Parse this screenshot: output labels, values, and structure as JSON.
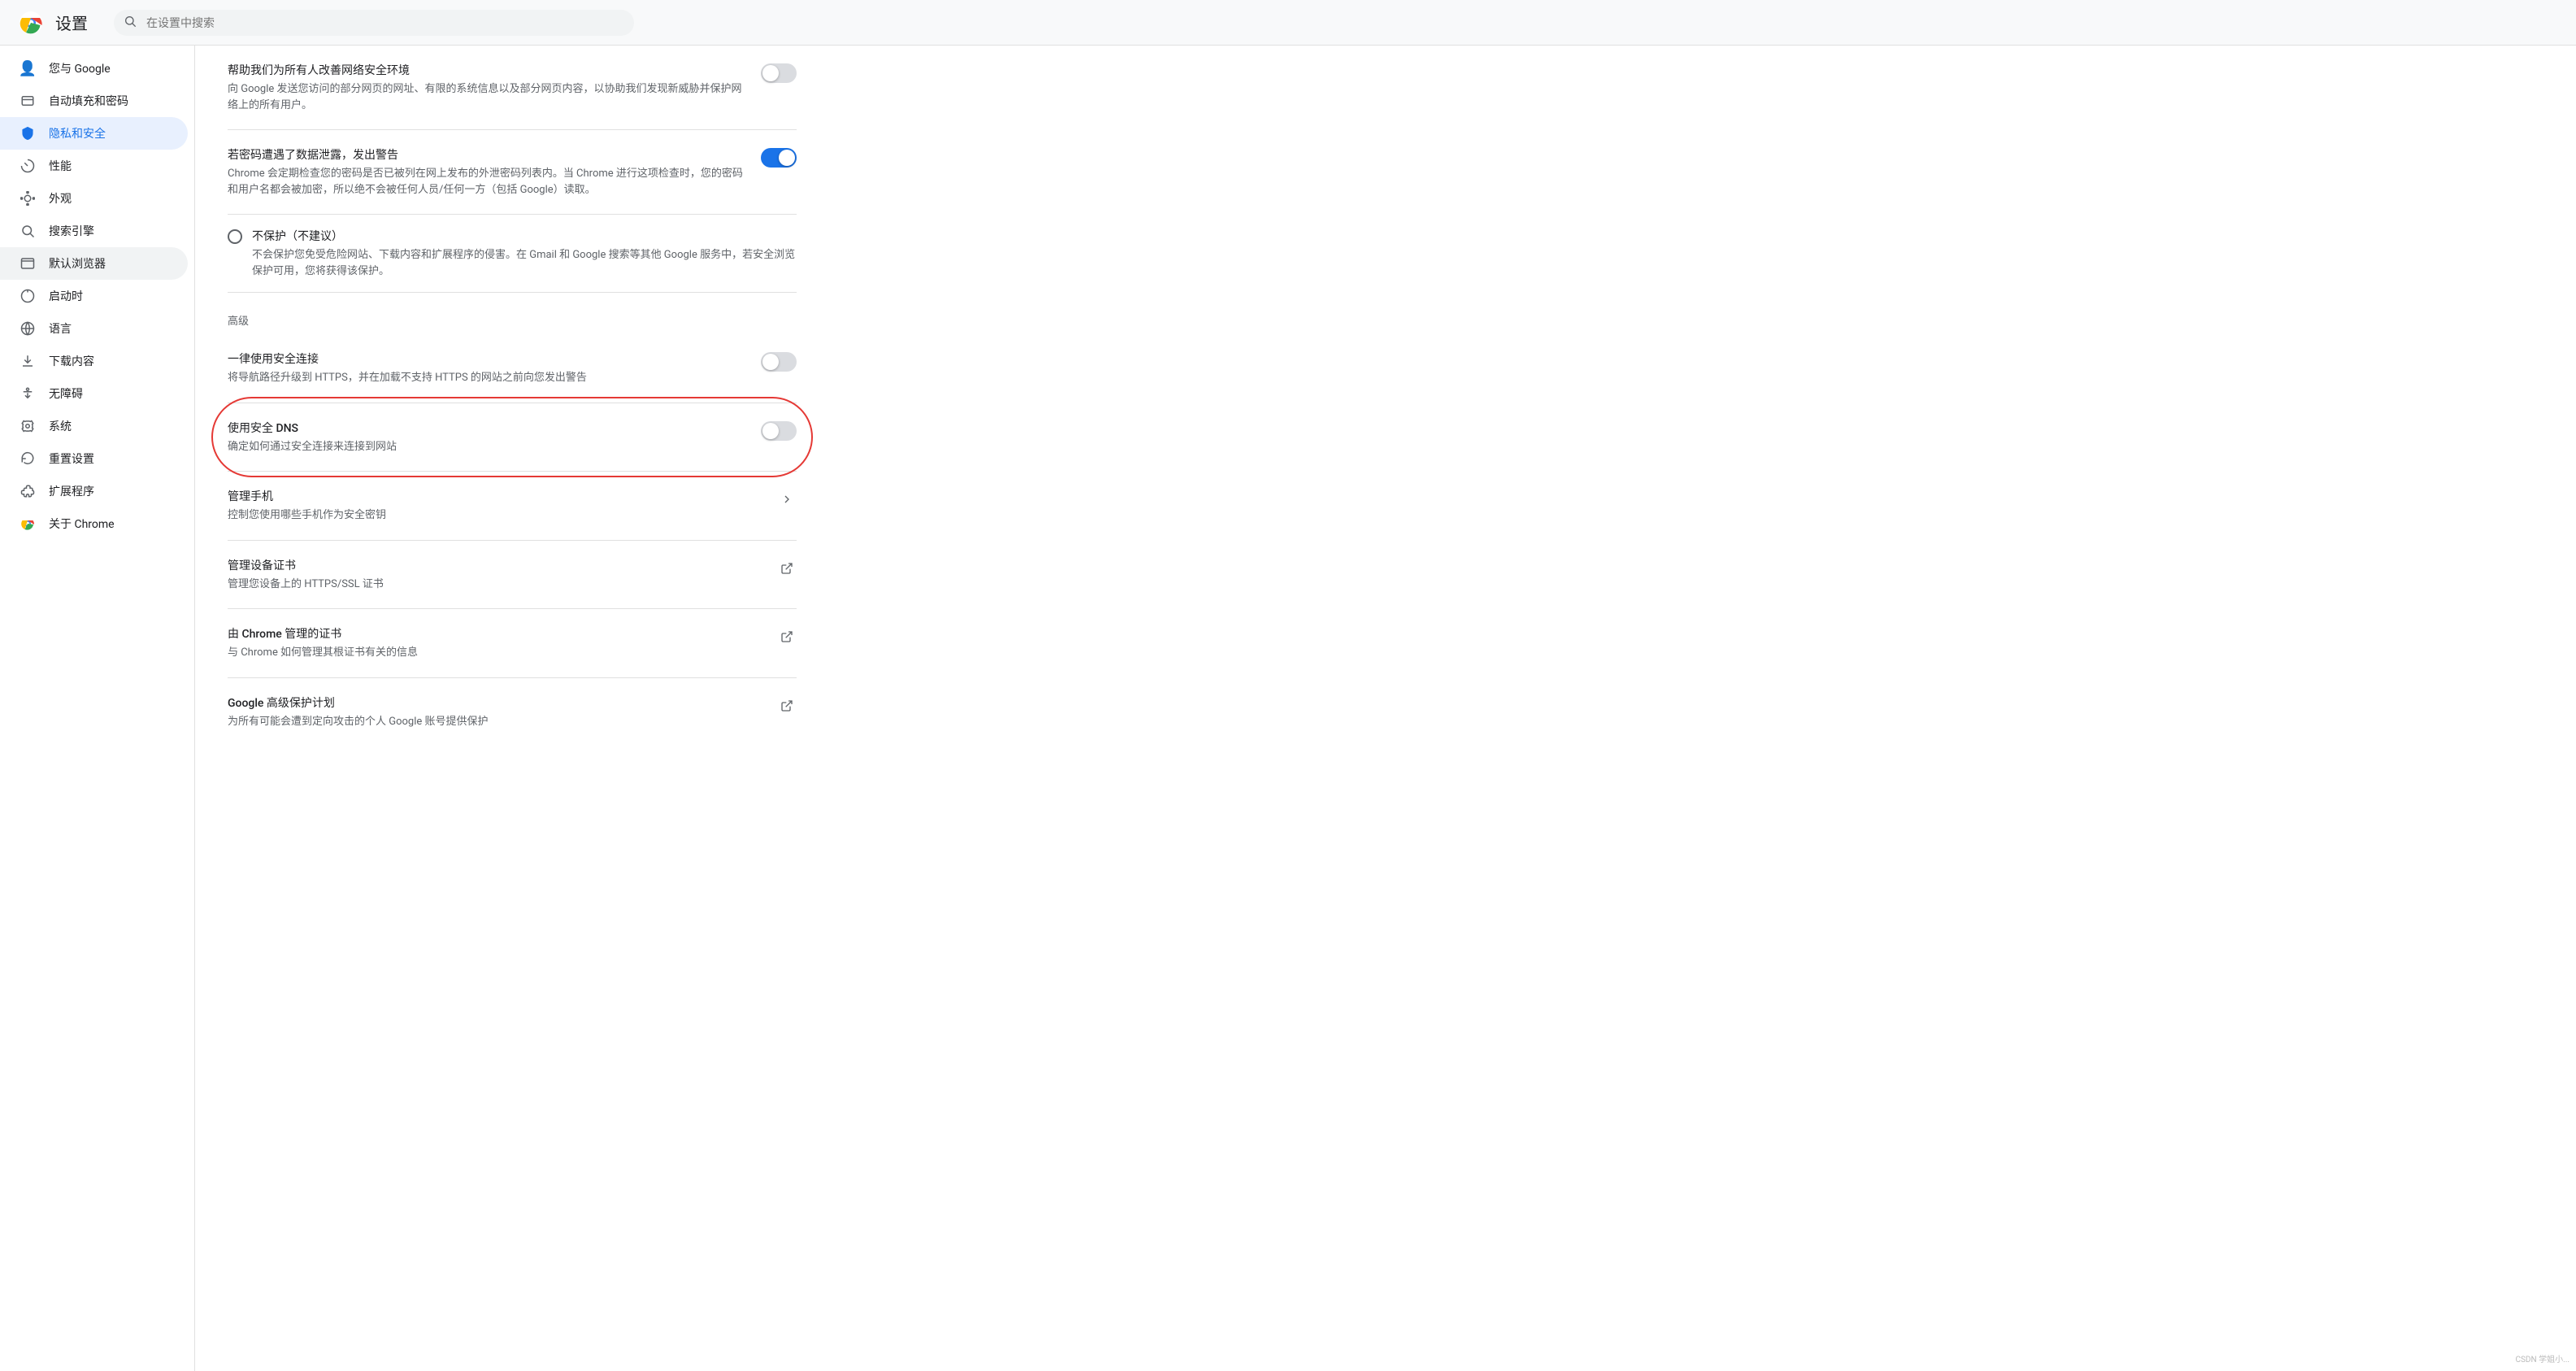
{
  "header": {
    "title": "设置",
    "search_placeholder": "在设置中搜索"
  },
  "sidebar": {
    "items": [
      {
        "id": "you-google",
        "label": "您与 Google",
        "icon": "👤"
      },
      {
        "id": "autofill",
        "label": "自动填充和密码",
        "icon": "🔄"
      },
      {
        "id": "privacy",
        "label": "隐私和安全",
        "icon": "🛡️",
        "active": true
      },
      {
        "id": "performance",
        "label": "性能",
        "icon": "⚡"
      },
      {
        "id": "appearance",
        "label": "外观",
        "icon": "🎨"
      },
      {
        "id": "search",
        "label": "搜索引擎",
        "icon": "🔍"
      },
      {
        "id": "default-browser",
        "label": "默认浏览器",
        "icon": "🖥️"
      },
      {
        "id": "startup",
        "label": "启动时",
        "icon": "🔌"
      },
      {
        "id": "languages",
        "label": "语言",
        "icon": "🌐"
      },
      {
        "id": "downloads",
        "label": "下载内容",
        "icon": "⬇️"
      },
      {
        "id": "accessibility",
        "label": "无障碍",
        "icon": "♿"
      },
      {
        "id": "system",
        "label": "系统",
        "icon": "🔧"
      },
      {
        "id": "reset",
        "label": "重置设置",
        "icon": "🔄"
      },
      {
        "id": "extensions",
        "label": "扩展程序",
        "icon": "🧩"
      },
      {
        "id": "about",
        "label": "关于 Chrome",
        "icon": "🌀"
      }
    ]
  },
  "content": {
    "help_network": {
      "title": "帮助我们为所有人改善网络安全环境",
      "desc": "向 Google 发送您访问的部分网页的网址、有限的系统信息以及部分网页内容，以协助我们发现新威胁并保护网络上的所有用户。",
      "toggle_state": "off"
    },
    "password_leak": {
      "title": "若密码遭遇了数据泄露，发出警告",
      "desc": "Chrome 会定期检查您的密码是否已被列在网上发布的外泄密码列表内。当 Chrome 进行这项检查时，您的密码和用户名都会被加密，所以绝不会被任何人员/任何一方（包括 Google）读取。",
      "toggle_state": "on"
    },
    "no_protection": {
      "title": "不保护（不建议）",
      "desc": "不会保护您免受危险网站、下载内容和扩展程序的侵害。在 Gmail 和 Google 搜索等其他 Google 服务中，若安全浏览保护可用，您将获得该保护。",
      "selected": false
    },
    "advanced_heading": "高级",
    "https_only": {
      "title": "一律使用安全连接",
      "desc": "将导航路径升级到 HTTPS，并在加载不支持 HTTPS 的网站之前向您发出警告",
      "toggle_state": "off"
    },
    "secure_dns": {
      "title": "使用安全 DNS",
      "desc": "确定如何通过安全连接来连接到网站",
      "toggle_state": "off",
      "highlighted": true
    },
    "manage_phone": {
      "title": "管理手机",
      "desc": "控制您使用哪些手机作为安全密钥",
      "has_arrow": true
    },
    "manage_device_certs": {
      "title": "管理设备证书",
      "desc": "管理您设备上的 HTTPS/SSL 证书",
      "has_external": true
    },
    "chrome_certs": {
      "title": "由 Chrome 管理的证书",
      "desc": "与 Chrome 如何管理其根证书有关的信息",
      "has_external": true
    },
    "google_advanced_protection": {
      "title": "Google 高级保护计划",
      "desc": "为所有可能会遭到定向攻击的个人 Google 账号提供保护",
      "has_external": true
    }
  },
  "watermark": "CSDN 学姐小..."
}
